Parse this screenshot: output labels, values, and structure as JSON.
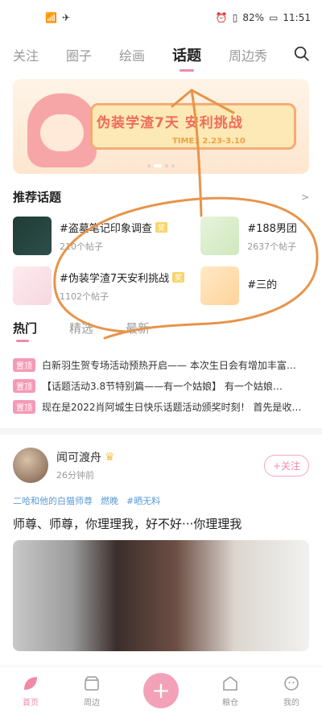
{
  "status": {
    "battery": "82%",
    "time": "11:51"
  },
  "top_tabs": [
    "关注",
    "圈子",
    "绘画",
    "话题",
    "周边秀"
  ],
  "active_tab": "话题",
  "banner": {
    "title": "伪装学渣7天 安利挑战",
    "time": "TIME：2.23-3.10"
  },
  "recommend": {
    "heading": "推荐话题",
    "more": ">"
  },
  "topics": [
    {
      "name": "#盗墓笔记印象调查",
      "badge": "奖",
      "count": "210个帖子"
    },
    {
      "name": "#188男团",
      "badge": "",
      "count": "2637个帖子"
    },
    {
      "name": "#伪装学渣7天安利挑战",
      "badge": "奖",
      "count": "1102个帖子"
    },
    {
      "name": "#三的",
      "badge": "",
      "count": ""
    }
  ],
  "feed_tabs": [
    "热门",
    "精选",
    "最新"
  ],
  "pinned": [
    {
      "tag": "置顶",
      "text": "白新羽生贺专场活动预热开启—— 本次生日会有增加丰富…"
    },
    {
      "tag": "置顶",
      "text": "【话题活动3.8节特别篇——有一个姑娘】 有一个姑娘…"
    },
    {
      "tag": "置顶",
      "text": "现在是2022肖阿城生日快乐话题活动颁奖时刻！ 首先是收…"
    }
  ],
  "post": {
    "user": "闻可渡舟",
    "time": "26分钟前",
    "follow": "+关注",
    "tags": [
      "二哈和他的白猫师尊",
      "燃晚",
      "#晒无料"
    ],
    "title": "师尊、师尊，你理理我，好不好···你理理我"
  },
  "bottom_nav": [
    "首页",
    "周边",
    "",
    "粮仓",
    "我的"
  ],
  "colors": {
    "accent": "#f08aa8",
    "scribble": "#e7944a"
  }
}
